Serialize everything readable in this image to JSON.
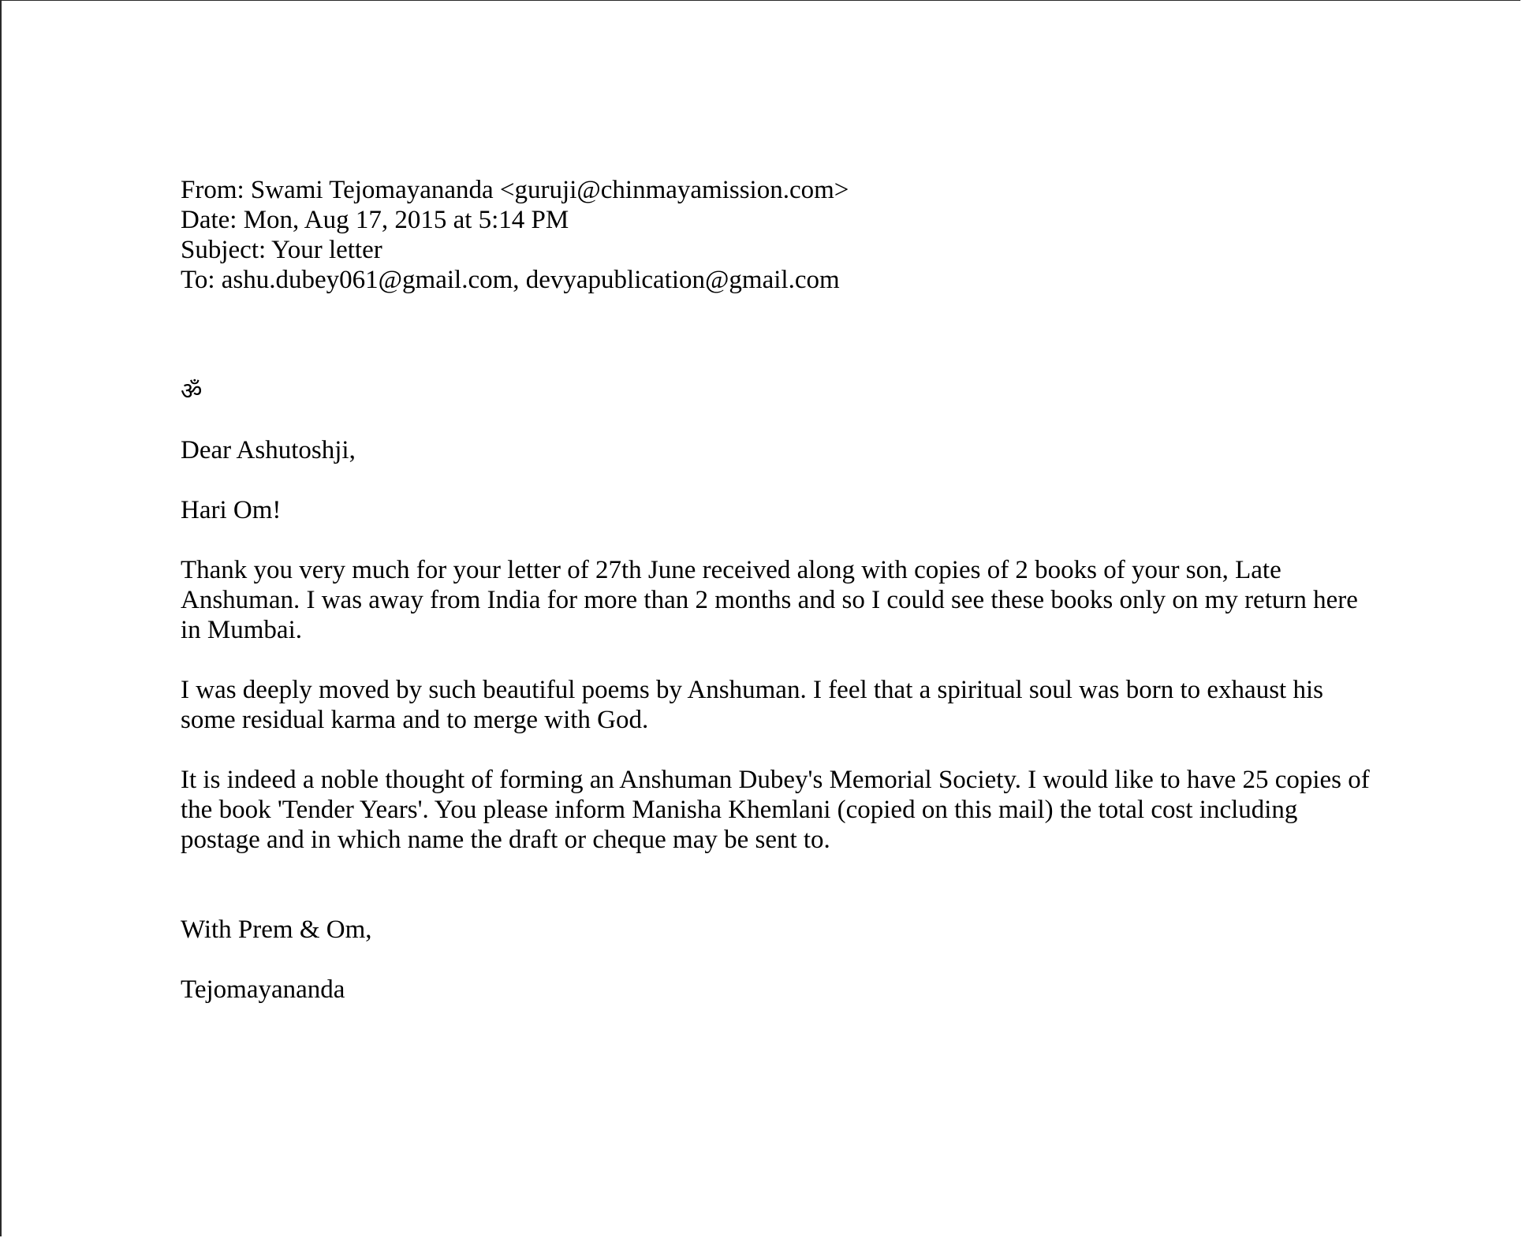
{
  "email_header": {
    "from": "From: Swami Tejomayananda <guruji@chinmayamission.com>",
    "date": "Date: Mon, Aug 17, 2015 at 5:14 PM",
    "subject": "Subject: Your letter",
    "to": "To: ashu.dubey061@gmail.com, devyapublication@gmail.com"
  },
  "letter": {
    "om_symbol": "ॐ",
    "salutation": "Dear Ashutoshji,",
    "greeting": "Hari Om!",
    "paragraphs": [
      "Thank you very much for your letter of 27th June received along with copies of 2 books of your son, Late Anshuman. I was away from India for more than 2 months and so I could see these books only on my return here in Mumbai.",
      "I was deeply moved by such beautiful poems by Anshuman. I feel that a spiritual soul was born to exhaust his some residual karma and to merge with God.",
      "It is indeed a noble thought of forming an Anshuman Dubey's Memorial Society. I would like to have 25 copies of the book 'Tender Years'. You please inform Manisha Khemlani (copied on this mail) the total cost including postage and in which name the draft or cheque may be sent to."
    ],
    "closing": "With Prem & Om,",
    "signature": "Tejomayananda"
  }
}
